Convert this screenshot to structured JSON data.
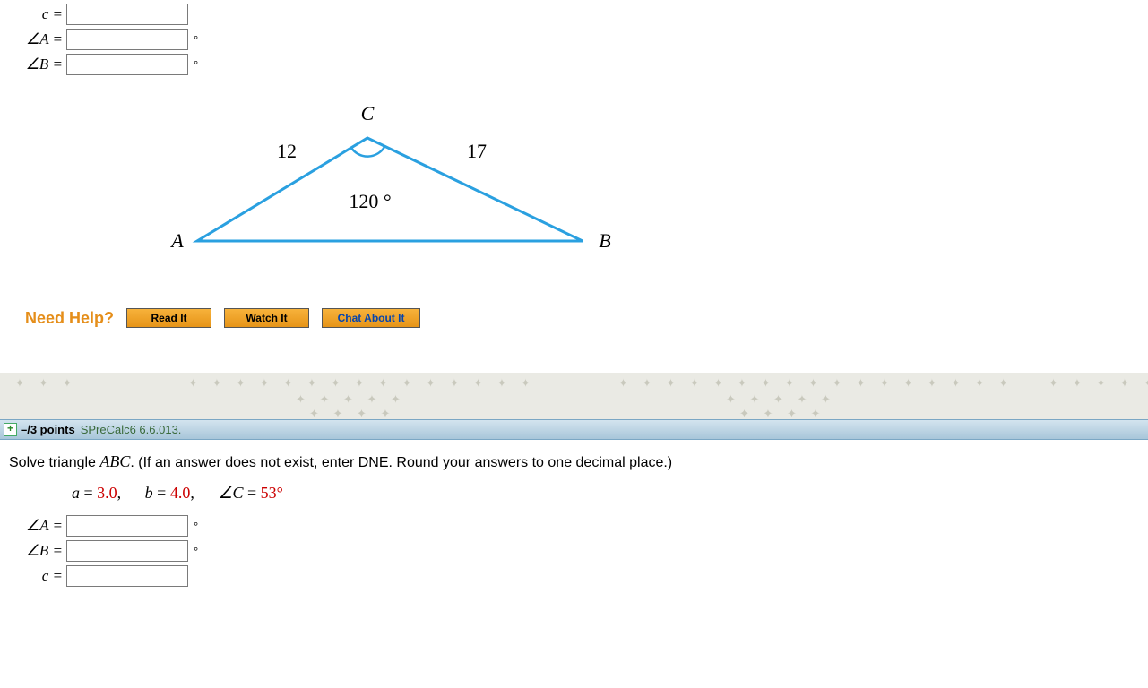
{
  "q1": {
    "inputs": {
      "c_label": "c =",
      "A_label": "∠A =",
      "B_label": "∠B ="
    },
    "deg": "°",
    "triangle": {
      "C": "C",
      "A": "A",
      "B": "B",
      "side_b": "12",
      "side_a": "17",
      "angle_C": "120 °"
    },
    "help": {
      "title": "Need Help?",
      "read": "Read It",
      "watch": "Watch It",
      "chat": "Chat About It"
    }
  },
  "q2": {
    "header": {
      "points": "–/3 points",
      "source": "SPreCalc6 6.6.013."
    },
    "instr_pre": "Solve triangle ",
    "instr_abc": "ABC",
    "instr_post": ". (If an answer does not exist, enter DNE. Round your answers to one decimal place.)",
    "given": {
      "a_lbl": "a",
      "eq": " = ",
      "a_val": "3.0",
      "b_lbl": "b",
      "b_val": "4.0",
      "C_lbl": "∠C",
      "C_val": "53°",
      "comma": ","
    },
    "inputs": {
      "A_label": "∠A =",
      "B_label": "∠B =",
      "c_label": "c ="
    },
    "deg": "°"
  },
  "chart_data": {
    "type": "triangle-diagram",
    "vertices": [
      "A",
      "B",
      "C"
    ],
    "sides": {
      "AC": 12,
      "BC": 17
    },
    "angles": {
      "C": 120
    }
  }
}
